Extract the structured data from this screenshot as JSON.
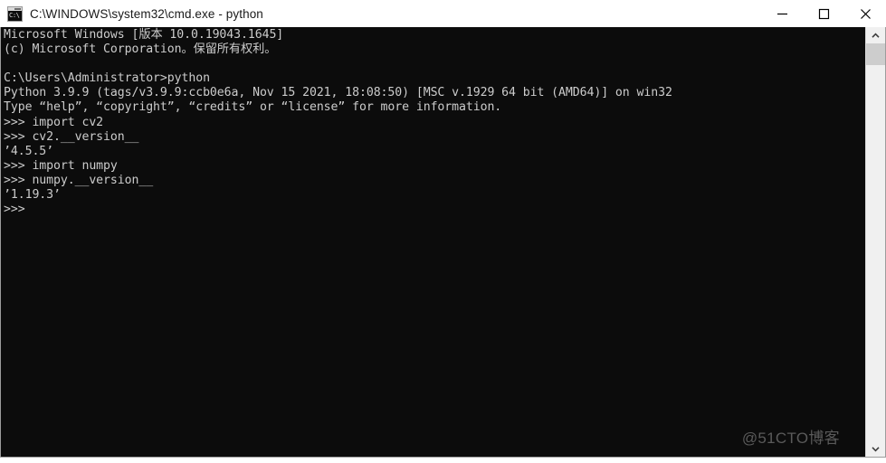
{
  "window": {
    "title": "C:\\WINDOWS\\system32\\cmd.exe - python",
    "icon": "cmd-console-icon",
    "icon_glyph": "C:\\",
    "controls": {
      "minimize": "minimize-button",
      "maximize": "maximize-button",
      "close": "close-button"
    }
  },
  "terminal": {
    "background_color": "#0c0c0c",
    "foreground_color": "#cccccc",
    "lines": [
      "Microsoft Windows [版本 10.0.19043.1645]",
      "(c) Microsoft Corporation。保留所有权利。",
      "",
      "C:\\Users\\Administrator>python",
      "Python 3.9.9 (tags/v3.9.9:ccb0e6a, Nov 15 2021, 18:08:50) [MSC v.1929 64 bit (AMD64)] on win32",
      "Type “help”, “copyright”, “credits” or “license” for more information.",
      ">>> import cv2",
      ">>> cv2.__version__",
      "’4.5.5’",
      ">>> import numpy",
      ">>> numpy.__version__",
      "’1.19.3’",
      ">>>"
    ],
    "text": "Microsoft Windows [版本 10.0.19043.1645]\n(c) Microsoft Corporation。保留所有权利。\n\nC:\\Users\\Administrator>python\nPython 3.9.9 (tags/v3.9.9:ccb0e6a, Nov 15 2021, 18:08:50) [MSC v.1929 64 bit (AMD64)] on win32\nType “help”, “copyright”, “credits” or “license” for more information.\n>>> import cv2\n>>> cv2.__version__\n’4.5.5’\n>>> import numpy\n>>> numpy.__version__\n’1.19.3’\n>>>"
  },
  "watermark": {
    "label": "@51CTO博客"
  },
  "scrollbar": {
    "up_arrow": "scroll-up-icon",
    "down_arrow": "scroll-down-icon",
    "thumb": "scrollbar-thumb"
  }
}
